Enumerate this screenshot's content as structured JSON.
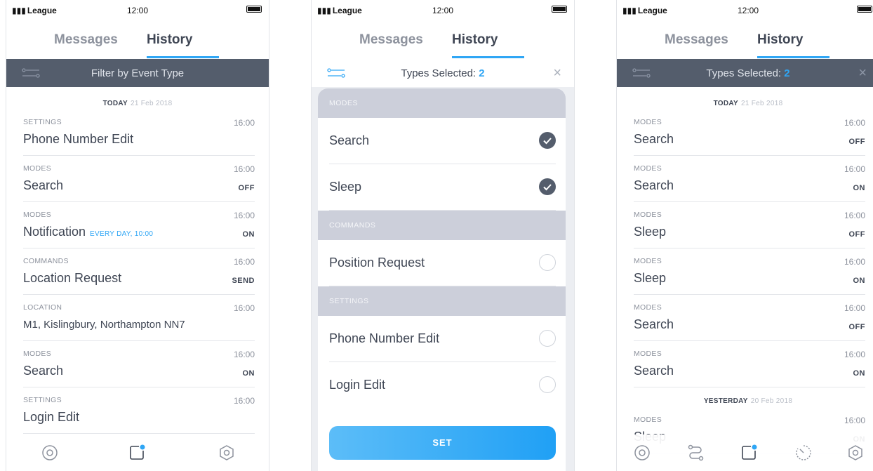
{
  "status": {
    "carrier": "League",
    "time": "12:00"
  },
  "tabs": {
    "messages": "Messages",
    "history": "History"
  },
  "colors": {
    "accent": "#2fa6f5",
    "dark_bar": "#545d6c",
    "section": "#cccfda"
  },
  "screen1": {
    "filter_placeholder": "Filter by Event Type",
    "day": {
      "label": "TODAY",
      "date": "21 Feb 2018"
    },
    "rows": [
      {
        "cat": "SETTINGS",
        "title": "Phone Number Edit",
        "time": "16:00",
        "state": "",
        "sub": ""
      },
      {
        "cat": "MODES",
        "title": "Search",
        "time": "16:00",
        "state": "OFF",
        "sub": ""
      },
      {
        "cat": "MODES",
        "title": "Notification",
        "time": "16:00",
        "state": "ON",
        "sub": "EVERY DAY, 10:00"
      },
      {
        "cat": "COMMANDS",
        "title": "Location Request",
        "time": "16:00",
        "state": "SEND",
        "sub": ""
      },
      {
        "cat": "LOCATION",
        "title": "M1, Kislingbury, Northampton NN7",
        "time": "16:00",
        "state": "",
        "sub": ""
      },
      {
        "cat": "MODES",
        "title": "Search",
        "time": "16:00",
        "state": "ON",
        "sub": ""
      },
      {
        "cat": "SETTINGS",
        "title": "Login Edit",
        "time": "16:00",
        "state": "",
        "sub": ""
      }
    ]
  },
  "screen2": {
    "types_label": "Types Selected:",
    "types_count": "2",
    "sections": [
      {
        "label": "MODES",
        "options": [
          {
            "label": "Search",
            "checked": true
          },
          {
            "label": "Sleep",
            "checked": true
          }
        ]
      },
      {
        "label": "COMMANDS",
        "options": [
          {
            "label": "Position Request",
            "checked": false
          }
        ]
      },
      {
        "label": "SETTINGS",
        "options": [
          {
            "label": "Phone Number Edit",
            "checked": false
          },
          {
            "label": "Login Edit",
            "checked": false
          }
        ]
      }
    ],
    "set_label": "SET"
  },
  "screen3": {
    "types_label": "Types Selected:",
    "types_count": "2",
    "today": {
      "label": "TODAY",
      "date": "21 Feb 2018"
    },
    "rows": [
      {
        "cat": "MODES",
        "title": "Search",
        "time": "16:00",
        "state": "OFF"
      },
      {
        "cat": "MODES",
        "title": "Search",
        "time": "16:00",
        "state": "ON"
      },
      {
        "cat": "MODES",
        "title": "Sleep",
        "time": "16:00",
        "state": "OFF"
      },
      {
        "cat": "MODES",
        "title": "Sleep",
        "time": "16:00",
        "state": "ON"
      },
      {
        "cat": "MODES",
        "title": "Search",
        "time": "16:00",
        "state": "OFF"
      },
      {
        "cat": "MODES",
        "title": "Search",
        "time": "16:00",
        "state": "ON"
      }
    ],
    "yesterday": {
      "label": "YESTERDAY",
      "date": "20 Feb 2018"
    },
    "rows_yesterday": [
      {
        "cat": "MODES",
        "title": "Sleep",
        "time": "16:00",
        "state": "ON"
      }
    ]
  }
}
